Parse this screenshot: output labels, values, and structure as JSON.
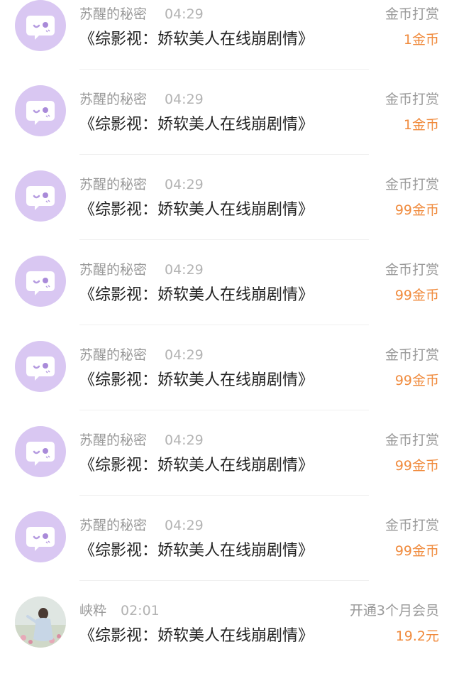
{
  "records": [
    {
      "name": "苏醒的秘密",
      "time": "04:29",
      "title": "《综影视：娇软美人在线崩剧情》",
      "type": "金币打赏",
      "amount": "1金币",
      "avatar": "chat-bubble-icon"
    },
    {
      "name": "苏醒的秘密",
      "time": "04:29",
      "title": "《综影视：娇软美人在线崩剧情》",
      "type": "金币打赏",
      "amount": "1金币",
      "avatar": "chat-bubble-icon"
    },
    {
      "name": "苏醒的秘密",
      "time": "04:29",
      "title": "《综影视：娇软美人在线崩剧情》",
      "type": "金币打赏",
      "amount": "99金币",
      "avatar": "chat-bubble-icon"
    },
    {
      "name": "苏醒的秘密",
      "time": "04:29",
      "title": "《综影视：娇软美人在线崩剧情》",
      "type": "金币打赏",
      "amount": "99金币",
      "avatar": "chat-bubble-icon"
    },
    {
      "name": "苏醒的秘密",
      "time": "04:29",
      "title": "《综影视：娇软美人在线崩剧情》",
      "type": "金币打赏",
      "amount": "99金币",
      "avatar": "chat-bubble-icon"
    },
    {
      "name": "苏醒的秘密",
      "time": "04:29",
      "title": "《综影视：娇软美人在线崩剧情》",
      "type": "金币打赏",
      "amount": "99金币",
      "avatar": "chat-bubble-icon"
    },
    {
      "name": "苏醒的秘密",
      "time": "04:29",
      "title": "《综影视：娇软美人在线崩剧情》",
      "type": "金币打赏",
      "amount": "99金币",
      "avatar": "chat-bubble-icon"
    },
    {
      "name": "峡粋",
      "time": "02:01",
      "title": "《综影视：娇软美人在线崩剧情》",
      "type": "开通3个月会员",
      "amount": "19.2元",
      "avatar": "user-photo"
    }
  ],
  "colors": {
    "avatar_bg": "#d9c7f2",
    "amount": "#f08a3c",
    "muted_text": "#999999",
    "title_text": "#222222"
  }
}
